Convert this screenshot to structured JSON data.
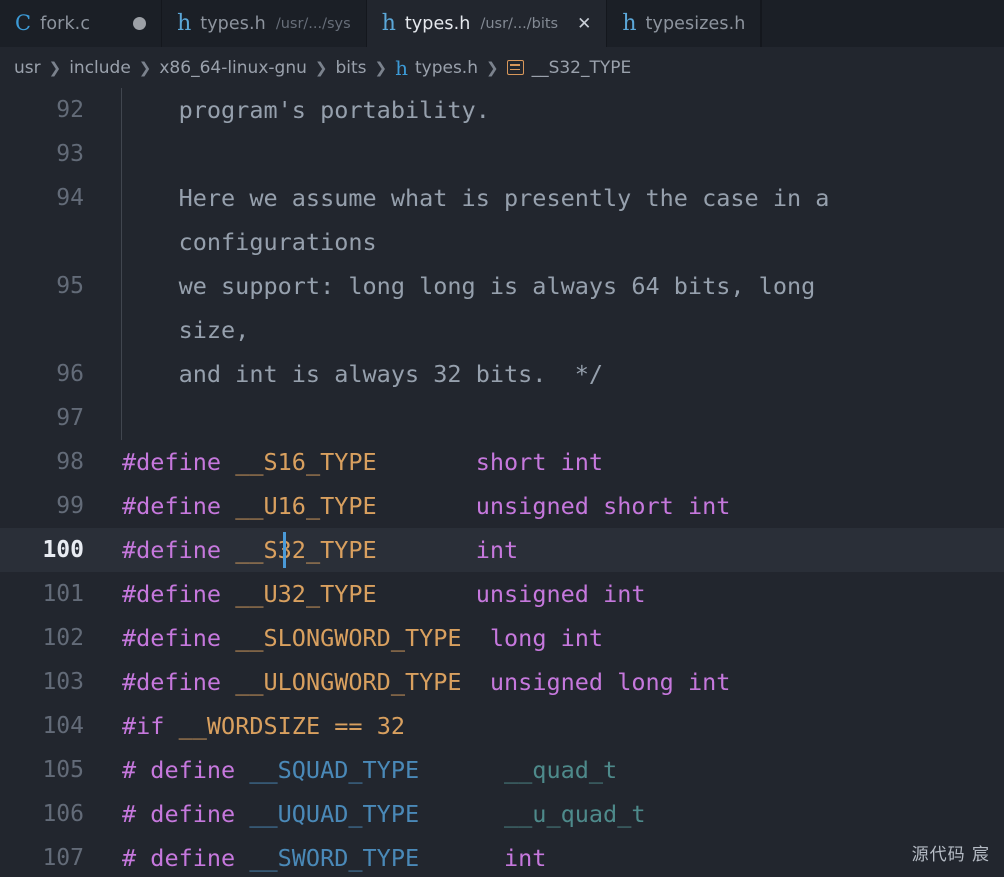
{
  "tabs": [
    {
      "icon": "c-file-icon",
      "icon_glyph": "C",
      "label": "fork.c",
      "desc": "",
      "active": false,
      "dirty": true,
      "closable": false
    },
    {
      "icon": "h-file-icon",
      "icon_glyph": "h",
      "label": "types.h",
      "desc": "/usr/.../sys",
      "active": false,
      "dirty": false,
      "closable": false
    },
    {
      "icon": "h-file-icon",
      "icon_glyph": "h",
      "label": "types.h",
      "desc": "/usr/.../bits",
      "active": true,
      "dirty": false,
      "closable": true,
      "close_glyph": "✕"
    },
    {
      "icon": "h-file-icon",
      "icon_glyph": "h",
      "label": "typesizes.h",
      "desc": "",
      "active": false,
      "dirty": false,
      "closable": false
    }
  ],
  "breadcrumb": {
    "separator": "❯",
    "items": [
      {
        "label": "usr",
        "icon": ""
      },
      {
        "label": "include",
        "icon": ""
      },
      {
        "label": "x86_64-linux-gnu",
        "icon": ""
      },
      {
        "label": "bits",
        "icon": ""
      },
      {
        "label": "types.h",
        "icon": "h-file-icon",
        "icon_glyph": "h"
      },
      {
        "label": "__S32_TYPE",
        "icon": "symbol-constant-icon"
      }
    ]
  },
  "editor": {
    "active_line": 100,
    "cursor": {
      "line": 100,
      "column": 9
    },
    "lines": [
      {
        "num": "92",
        "segments": [
          {
            "t": "    program's portability.",
            "c": "tok-comment"
          }
        ]
      },
      {
        "num": "93",
        "segments": [
          {
            "t": "",
            "c": "tok-comment"
          }
        ]
      },
      {
        "num": "94",
        "segments": [
          {
            "t": "    Here we assume what is presently the case in a",
            "c": "tok-comment"
          }
        ]
      },
      {
        "num": "",
        "segments": [
          {
            "t": "    configurations",
            "c": "tok-comment"
          }
        ]
      },
      {
        "num": "95",
        "segments": [
          {
            "t": "    we support: long long is always 64 bits, long",
            "c": "tok-comment"
          }
        ]
      },
      {
        "num": "",
        "segments": [
          {
            "t": "    size,",
            "c": "tok-comment"
          }
        ]
      },
      {
        "num": "96",
        "segments": [
          {
            "t": "    and int is always 32 bits.  */",
            "c": "tok-comment"
          }
        ]
      },
      {
        "num": "97",
        "segments": [
          {
            "t": "",
            "c": "tok-comment"
          }
        ]
      },
      {
        "num": "98",
        "segments": [
          {
            "t": "#define",
            "c": "tok-pre"
          },
          {
            "t": " ",
            "c": ""
          },
          {
            "t": "__S16_TYPE",
            "c": "tok-macro"
          },
          {
            "t": "       ",
            "c": ""
          },
          {
            "t": "short int",
            "c": "tok-type"
          }
        ]
      },
      {
        "num": "99",
        "segments": [
          {
            "t": "#define",
            "c": "tok-pre"
          },
          {
            "t": " ",
            "c": ""
          },
          {
            "t": "__U16_TYPE",
            "c": "tok-macro"
          },
          {
            "t": "       ",
            "c": ""
          },
          {
            "t": "unsigned short int",
            "c": "tok-type"
          }
        ]
      },
      {
        "num": "100",
        "segments": [
          {
            "t": "#define",
            "c": "tok-pre"
          },
          {
            "t": " ",
            "c": ""
          },
          {
            "t": "__S32_TYPE",
            "c": "tok-macro"
          },
          {
            "t": "       ",
            "c": ""
          },
          {
            "t": "int",
            "c": "tok-type"
          }
        ]
      },
      {
        "num": "101",
        "segments": [
          {
            "t": "#define",
            "c": "tok-pre"
          },
          {
            "t": " ",
            "c": ""
          },
          {
            "t": "__U32_TYPE",
            "c": "tok-macro"
          },
          {
            "t": "       ",
            "c": ""
          },
          {
            "t": "unsigned int",
            "c": "tok-type"
          }
        ]
      },
      {
        "num": "102",
        "segments": [
          {
            "t": "#define",
            "c": "tok-pre"
          },
          {
            "t": " ",
            "c": ""
          },
          {
            "t": "__SLONGWORD_TYPE",
            "c": "tok-macro"
          },
          {
            "t": "  ",
            "c": ""
          },
          {
            "t": "long int",
            "c": "tok-type"
          }
        ]
      },
      {
        "num": "103",
        "segments": [
          {
            "t": "#define",
            "c": "tok-pre"
          },
          {
            "t": " ",
            "c": ""
          },
          {
            "t": "__ULONGWORD_TYPE",
            "c": "tok-macro"
          },
          {
            "t": "  ",
            "c": ""
          },
          {
            "t": "unsigned long int",
            "c": "tok-type"
          }
        ]
      },
      {
        "num": "104",
        "segments": [
          {
            "t": "#if",
            "c": "tok-pre"
          },
          {
            "t": " ",
            "c": ""
          },
          {
            "t": "__WORDSIZE",
            "c": "tok-macro"
          },
          {
            "t": " ",
            "c": ""
          },
          {
            "t": "==",
            "c": "tok-op"
          },
          {
            "t": " ",
            "c": ""
          },
          {
            "t": "32",
            "c": "tok-num"
          }
        ]
      },
      {
        "num": "105",
        "segments": [
          {
            "t": "# define",
            "c": "tok-pre"
          },
          {
            "t": " ",
            "c": ""
          },
          {
            "t": "__SQUAD_TYPE",
            "c": "tok-macro-b"
          },
          {
            "t": "      ",
            "c": ""
          },
          {
            "t": "__quad_t",
            "c": "tok-teal"
          }
        ]
      },
      {
        "num": "106",
        "segments": [
          {
            "t": "# define",
            "c": "tok-pre"
          },
          {
            "t": " ",
            "c": ""
          },
          {
            "t": "__UQUAD_TYPE",
            "c": "tok-macro-b"
          },
          {
            "t": "      ",
            "c": ""
          },
          {
            "t": "__u_quad_t",
            "c": "tok-teal"
          }
        ]
      },
      {
        "num": "107",
        "segments": [
          {
            "t": "# define",
            "c": "tok-pre"
          },
          {
            "t": " ",
            "c": ""
          },
          {
            "t": "__SWORD_TYPE",
            "c": "tok-macro-b"
          },
          {
            "t": "      ",
            "c": ""
          },
          {
            "t": "int",
            "c": "tok-type"
          }
        ]
      }
    ]
  },
  "watermark": {
    "text": "源代码  宸"
  }
}
